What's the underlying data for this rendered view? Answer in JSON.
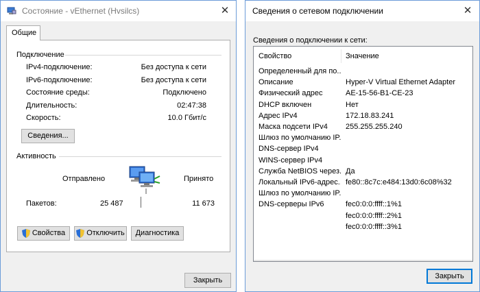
{
  "left_window": {
    "title": "Состояние - vEthernet (Hvsilcs)",
    "tab": "Общие",
    "connection": {
      "header": "Подключение",
      "rows": [
        {
          "label": "IPv4-подключение:",
          "value": "Без доступа к сети"
        },
        {
          "label": "IPv6-подключение:",
          "value": "Без доступа к сети"
        },
        {
          "label": "Состояние среды:",
          "value": "Подключено"
        },
        {
          "label": "Длительность:",
          "value": "02:47:38"
        },
        {
          "label": "Скорость:",
          "value": "10.0 Гбит/с"
        }
      ],
      "details_button": "Сведения..."
    },
    "activity": {
      "header": "Активность",
      "sent_label": "Отправлено",
      "received_label": "Принято",
      "packets_label": "Пакетов:",
      "packets_sent": "25 487",
      "packets_received": "11 673"
    },
    "buttons": {
      "properties": "Свойства",
      "disable": "Отключить",
      "diagnose": "Диагностика",
      "close": "Закрыть"
    }
  },
  "right_window": {
    "title": "Сведения о сетевом подключении",
    "subtitle": "Сведения о подключении к сети:",
    "col_property": "Свойство",
    "col_value": "Значение",
    "rows": [
      {
        "property": "Определенный для по...",
        "value": ""
      },
      {
        "property": "Описание",
        "value": "Hyper-V Virtual Ethernet Adapter"
      },
      {
        "property": "Физический адрес",
        "value": "AE-15-56-B1-CE-23"
      },
      {
        "property": "DHCP включен",
        "value": "Нет"
      },
      {
        "property": "Адрес IPv4",
        "value": "172.18.83.241"
      },
      {
        "property": "Маска подсети IPv4",
        "value": "255.255.255.240"
      },
      {
        "property": "Шлюз по умолчанию IP...",
        "value": ""
      },
      {
        "property": "DNS-сервер IPv4",
        "value": ""
      },
      {
        "property": "WINS-сервер IPv4",
        "value": ""
      },
      {
        "property": "Служба NetBIOS через...",
        "value": "Да"
      },
      {
        "property": "Локальный IPv6-адрес...",
        "value": "fe80::8c7c:e484:13d0:6c08%32"
      },
      {
        "property": "Шлюз по умолчанию IP...",
        "value": ""
      },
      {
        "property": "DNS-серверы IPv6",
        "value": "fec0:0:0:ffff::1%1"
      },
      {
        "property": "",
        "value": "fec0:0:0:ffff::2%1"
      },
      {
        "property": "",
        "value": "fec0:0:0:ffff::3%1"
      }
    ],
    "close": "Закрыть"
  }
}
